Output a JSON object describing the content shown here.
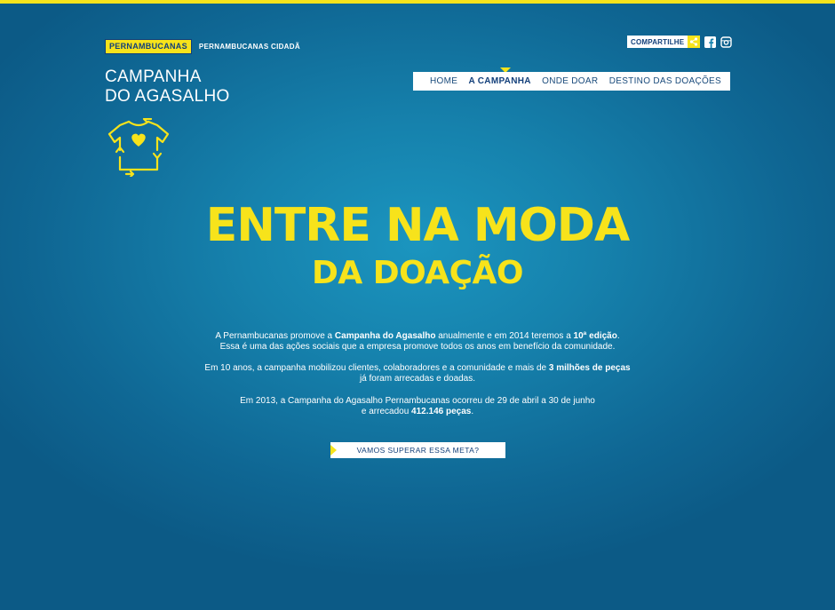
{
  "colors": {
    "accent": "#f7e31b",
    "background": "#1682ad",
    "navy": "#123f7a"
  },
  "brand": {
    "logo": "PERNAMBUCANAS",
    "subtitle": "PERNAMBUCANAS CIDADÃ"
  },
  "campaign": {
    "title_line1": "CAMPANHA",
    "title_line2": "DO AGASALHO",
    "icon": "tshirt-heart-recycle-icon"
  },
  "share": {
    "label": "COMPARTILHE",
    "icons": [
      "share-icon",
      "facebook-icon",
      "instagram-icon"
    ]
  },
  "nav": {
    "items": [
      {
        "label": "HOME"
      },
      {
        "label": "A CAMPANHA",
        "active": true
      },
      {
        "label": "ONDE DOAR"
      },
      {
        "label": "DESTINO DAS DOAÇÕES"
      }
    ]
  },
  "hero": {
    "line1": "ENTRE NA MODA",
    "line2": "DA DOAÇÃO"
  },
  "paragraphs": {
    "p1_a": "A Pernambucanas promove a ",
    "p1_b": "Campanha do Agasalho",
    "p1_c": " anualmente e em 2014 teremos a ",
    "p1_d": "10ª edição",
    "p1_e": ".",
    "p1_line2": "Essa é uma das ações sociais que a empresa promove todos os anos em benefício da comunidade.",
    "p2_a": "Em 10 anos, a campanha mobilizou clientes, colaboradores e a comunidade e mais de ",
    "p2_b": "3 milhões de peças",
    "p2_line2": "já foram arrecadas e doadas.",
    "p3_line1": "Em 2013, a Campanha do Agasalho Pernambucanas ocorreu de 29 de abril a 30 de junho",
    "p3_a": "e arrecadou ",
    "p3_b": "412.146 peças",
    "p3_c": "."
  },
  "cta": {
    "label": "VAMOS SUPERAR ESSA META?"
  }
}
